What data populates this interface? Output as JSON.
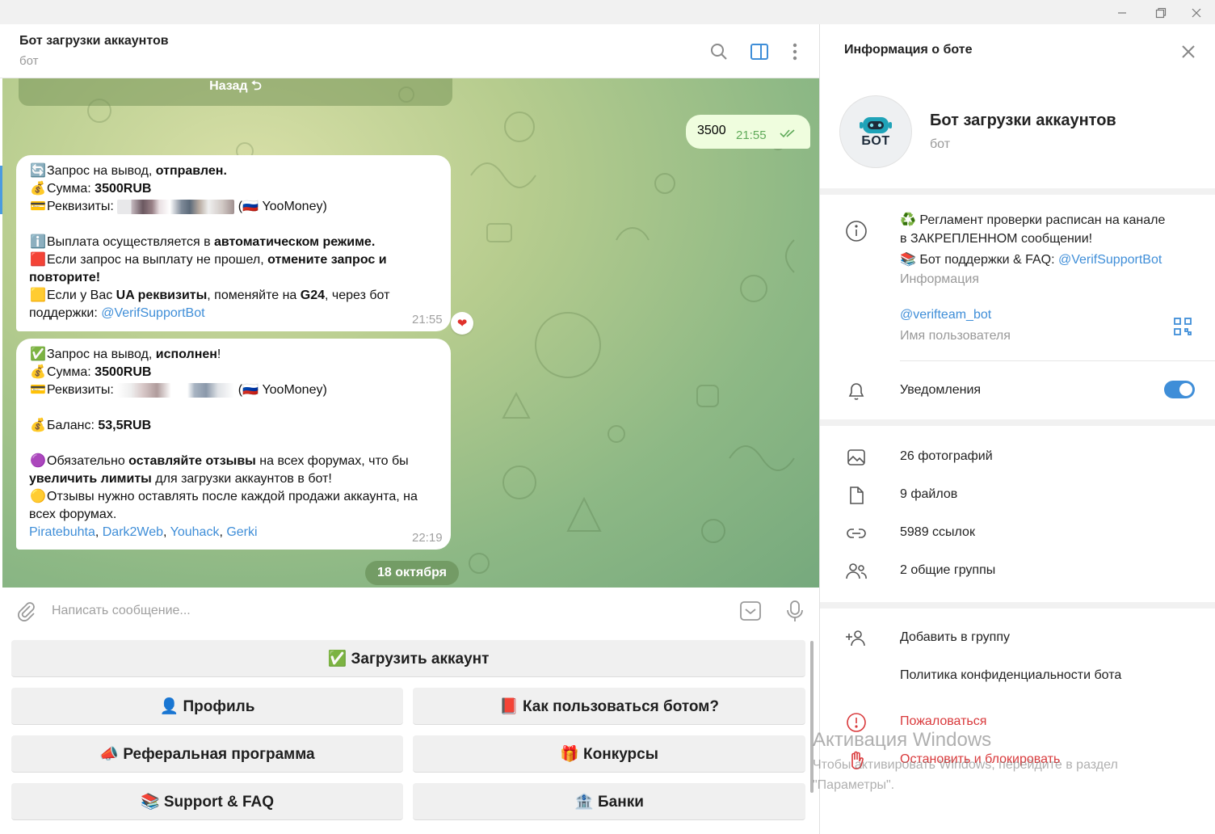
{
  "window": {
    "controls": [
      "minimize",
      "maximize",
      "close"
    ]
  },
  "chat_header": {
    "title": "Бот загрузки аккаунтов",
    "subtitle": "бот"
  },
  "keyboard_top_partial": "Назад ⮌",
  "outgoing": {
    "text": "3500",
    "time": "21:55"
  },
  "msg1": {
    "l1_pre": "Запрос на вывод, ",
    "l1_bold": "отправлен.",
    "l2_pre": "Сумма: ",
    "l2_bold": "3500RUB",
    "l3_pre": "Реквизиты: ",
    "l3_post": " YooMoney)",
    "l4_pre": "Выплата осуществляется в ",
    "l4_bold": "автоматическом режиме.",
    "l5_pre": "Если запрос на выплату не прошел, ",
    "l5_bold": "отмените запрос и",
    "l6_bold": "повторите!",
    "l7_pre": "Если у Вас ",
    "l7_bold": "UA реквизиты",
    "l7_mid": ", поменяйте на ",
    "l7_bold2": "G24",
    "l7_post": ", через бот",
    "l8_pre": "поддержки: ",
    "l8_link": "@VerifSupportBot",
    "time": "21:55"
  },
  "msg2": {
    "l1_pre": "Запрос на вывод, ",
    "l1_bold": "исполнен",
    "l1_post": "!",
    "l2_pre": "Сумма: ",
    "l2_bold": "3500RUB",
    "l3_pre": "Реквизиты: ",
    "l3_post": " YooMoney)",
    "l4_pre": "Баланс: ",
    "l4_bold": "53,5RUB",
    "l5_pre": "Обязательно ",
    "l5_bold": "оставляйте отзывы",
    "l5_post": " на всех форумах, что бы",
    "l6_bold": "увеличить лимиты",
    "l6_post": " для загрузки аккаунтов в бот!",
    "l7": "Отзывы нужно оставлять после каждой продажи аккаунта, на",
    "l8": "всех форумах.",
    "links": [
      "Piratebuhta",
      "Dark2Web",
      "Youhack",
      "Gerki"
    ],
    "time": "22:19"
  },
  "date_pill": "18 октября",
  "composer": {
    "placeholder": "Написать сообщение..."
  },
  "keyboard": {
    "upload": "✅ Загрузить аккаунт",
    "profile": "👤 Профиль",
    "howto": "📕 Как пользоваться ботом?",
    "referral": "📣 Реферальная программа",
    "contests": "🎁 Конкурсы",
    "support": "📚 Support & FAQ",
    "banks": "🏦 Банки"
  },
  "panel": {
    "title": "Информация о боте",
    "avatar_text": "БОТ",
    "name": "Бот загрузки аккаунтов",
    "kind": "бот",
    "desc_line1": "♻️ Регламент проверки расписан на канале",
    "desc_line2": "в ЗАКРЕПЛЕННОМ сообщении!",
    "desc_line3_pre": "📚 Бот поддержки & FAQ: ",
    "desc_line3_link": "@VerifSupportBot",
    "desc_label": "Информация",
    "username": "@verifteam_bot",
    "username_label": "Имя пользователя",
    "notifications": "Уведомления",
    "notifications_on": true,
    "photos": "26 фотографий",
    "files": "9 файлов",
    "links": "5989 ссылок",
    "groups": "2 общие группы",
    "add_to_group": "Добавить в группу",
    "privacy": "Политика конфиденциальности бота",
    "report": "Пожаловаться",
    "block": "Остановить и блокировать"
  },
  "watermark": {
    "title": "Активация Windows",
    "line1": "Чтобы активировать Windows, перейдите в раздел",
    "line2": "\"Параметры\"."
  },
  "colors": {
    "accent": "#3f8ed8",
    "outgoing_bubble": "#effdde",
    "danger": "#d9393b"
  }
}
